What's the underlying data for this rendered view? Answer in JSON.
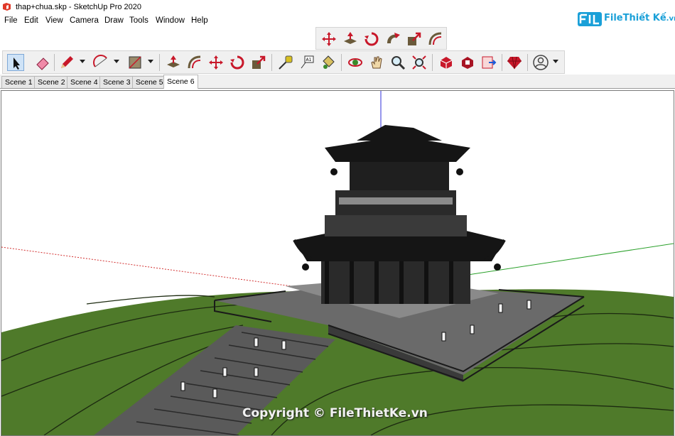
{
  "window": {
    "title": "thap+chua.skp - SketchUp Pro 2020"
  },
  "menu": {
    "items": [
      "File",
      "Edit",
      "View",
      "Camera",
      "Draw",
      "Tools",
      "Window",
      "Help"
    ]
  },
  "logo": {
    "text": "FileThiết Kế",
    "suffix": ".vn"
  },
  "toolbar_top": {
    "tools": [
      "move-icon",
      "push-pull-icon",
      "rotate-icon",
      "follow-me-icon",
      "scale-icon",
      "offset-icon"
    ]
  },
  "toolbar_main": {
    "tools": [
      "select-icon",
      "eraser-icon",
      "pencil-icon",
      "arc-icon",
      "rectangle-icon",
      "push-pull-icon",
      "offset-icon",
      "move-icon",
      "rotate-icon",
      "scale-icon",
      "tape-measure-icon",
      "text-icon",
      "paint-bucket-icon",
      "orbit-icon",
      "pan-icon",
      "zoom-icon",
      "zoom-extents-icon",
      "3d-warehouse-icon",
      "extension-warehouse-icon",
      "layout-icon",
      "extension-manager-icon",
      "account-icon"
    ]
  },
  "scenes": {
    "tabs": [
      "Scene 1",
      "Scene 2",
      "Scene 4",
      "Scene 3",
      "Scene 5",
      "Scene 6"
    ],
    "active": "Scene 6"
  },
  "copyright": {
    "text": "Copyright © FileThietKe.vn"
  },
  "colors": {
    "ground": "#4f7a2a",
    "toolbar_bg": "#f0f0f0",
    "logo_blue": "#1aa0d8",
    "axis_red": "#d23030",
    "axis_green": "#2aa02a",
    "axis_blue": "#5050e0"
  }
}
